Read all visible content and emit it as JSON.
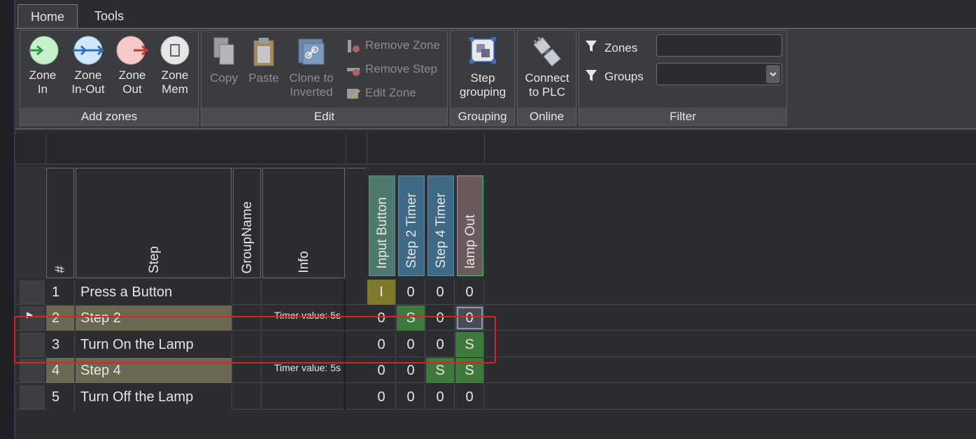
{
  "tabs": [
    {
      "label": "Home"
    },
    {
      "label": "Tools"
    }
  ],
  "ribbon": {
    "add_zones": {
      "label": "Add zones",
      "buttons": [
        {
          "l1": "Zone",
          "l2": "In"
        },
        {
          "l1": "Zone",
          "l2": "In-Out"
        },
        {
          "l1": "Zone",
          "l2": "Out"
        },
        {
          "l1": "Zone",
          "l2": "Mem"
        }
      ]
    },
    "edit": {
      "label": "Edit",
      "copy": "Copy",
      "paste": "Paste",
      "clone_l1": "Clone to",
      "clone_l2": "Inverted",
      "remove_zone": "Remove Zone",
      "remove_step": "Remove Step",
      "edit_zone": "Edit Zone"
    },
    "grouping": {
      "label": "Grouping",
      "l1": "Step",
      "l2": "grouping"
    },
    "online": {
      "label": "Online",
      "l1": "Connect",
      "l2": "to PLC"
    },
    "filter": {
      "label": "Filter",
      "zones": "Zones",
      "groups": "Groups",
      "zones_value": "",
      "groups_value": ""
    }
  },
  "table": {
    "headers": {
      "num": "#",
      "step": "Step",
      "group": "GroupName",
      "info": "Info"
    },
    "io_headers": [
      {
        "label": "Input Button",
        "color": "#4e7a6e"
      },
      {
        "label": "Step 2 Timer",
        "color": "#3f6a86"
      },
      {
        "label": "Step 4 Timer",
        "color": "#3f6a86"
      },
      {
        "label": "lamp Out",
        "color": "#6a5a5c"
      }
    ],
    "rows": [
      {
        "num": "1",
        "step": "Press a Button",
        "info": "",
        "vals": [
          "I",
          "0",
          "0",
          "0"
        ]
      },
      {
        "num": "2",
        "step": "Step 2",
        "info": "Timer value: 5s",
        "vals": [
          "0",
          "S",
          "0",
          "0"
        ]
      },
      {
        "num": "3",
        "step": "Turn On the Lamp",
        "info": "",
        "vals": [
          "0",
          "0",
          "0",
          "S"
        ]
      },
      {
        "num": "4",
        "step": "Step 4",
        "info": "Timer value: 5s",
        "vals": [
          "0",
          "0",
          "S",
          "S"
        ]
      },
      {
        "num": "5",
        "step": "Turn Off the Lamp",
        "info": "",
        "vals": [
          "0",
          "0",
          "0",
          "0"
        ]
      }
    ]
  },
  "colors": {
    "active_input": "#7d7a2c",
    "active_set": "#3f7a3c",
    "timer_row": "#6a6850"
  }
}
